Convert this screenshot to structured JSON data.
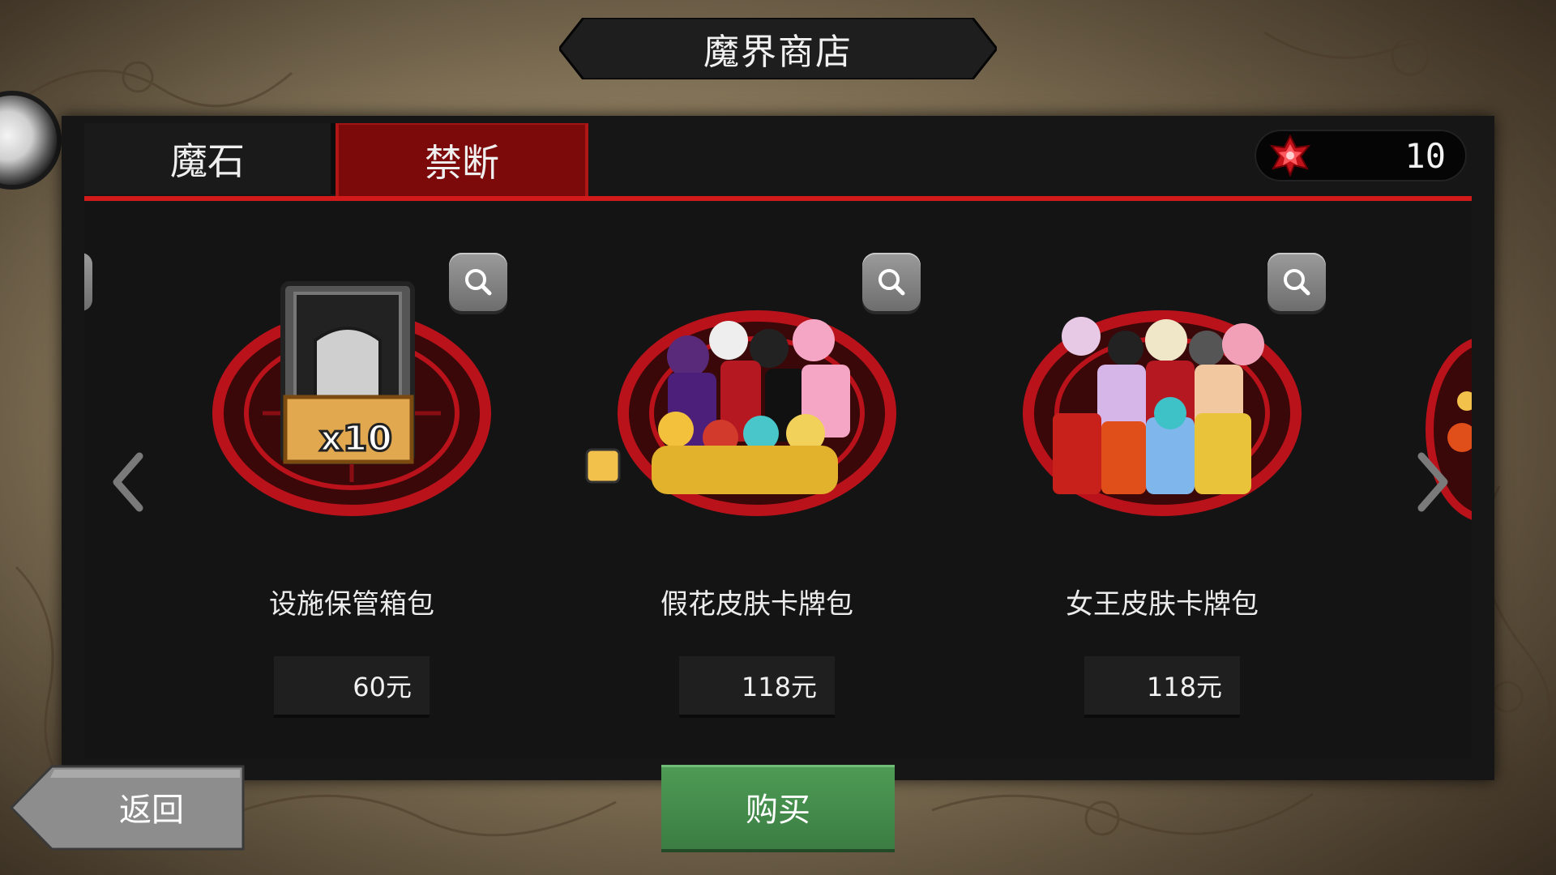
{
  "header": {
    "title": "魔界商店"
  },
  "tabs": [
    {
      "label": "魔石",
      "active": false
    },
    {
      "label": "禁断",
      "active": true
    }
  ],
  "currency": {
    "icon": "red-gem-icon",
    "value": "10"
  },
  "products": [
    {
      "name": "设施保管箱包",
      "price": "60元",
      "badge": "x10",
      "art": "storage-box-icon"
    },
    {
      "name": "假花皮肤卡牌包",
      "price": "118元",
      "art": "character-group-art"
    },
    {
      "name": "女王皮肤卡牌包",
      "price": "118元",
      "art": "character-group-art"
    }
  ],
  "buttons": {
    "back": "返回",
    "buy": "购买"
  },
  "colors": {
    "accent_red": "#d31a1a",
    "active_tab": "#7d0a0a",
    "buy_green": "#46904d",
    "panel": "#161616"
  }
}
